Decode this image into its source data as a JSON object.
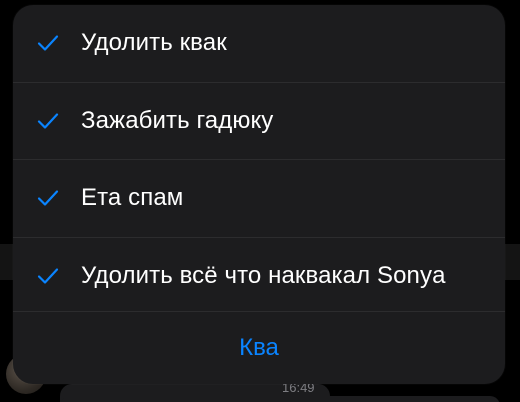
{
  "background": {
    "time_text": "16:49"
  },
  "action_sheet": {
    "items": [
      {
        "label": "Удолить квак",
        "checked": true,
        "icon": "checkmark-icon"
      },
      {
        "label": "Зажабить гадюку",
        "checked": true,
        "icon": "checkmark-icon"
      },
      {
        "label": "Ета спам",
        "checked": true,
        "icon": "checkmark-icon"
      },
      {
        "label": "Удолить всё что наквакал Sonya",
        "checked": true,
        "icon": "checkmark-icon"
      }
    ],
    "confirm_label": "Ква"
  },
  "colors": {
    "accent": "#0a84ff",
    "sheet_background": "#1c1c1e",
    "text": "#ffffff"
  }
}
